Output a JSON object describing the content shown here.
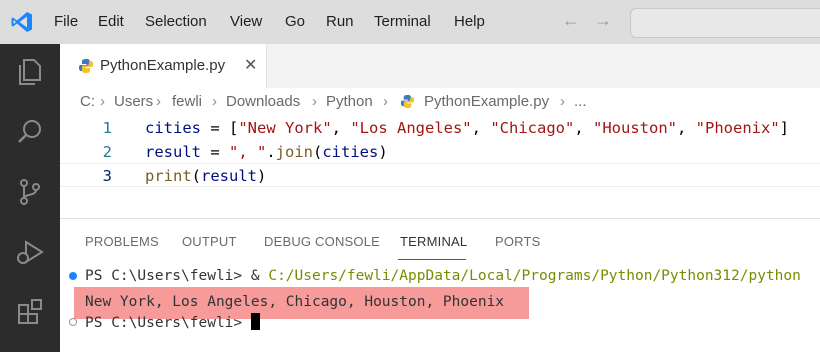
{
  "menu": [
    "File",
    "Edit",
    "Selection",
    "View",
    "Go",
    "Run",
    "Terminal",
    "Help"
  ],
  "colors": {
    "accent": "#1a85ff",
    "activitybar": "#2c2c2c",
    "highlight": "#f69a9a"
  },
  "tab": {
    "label": "PythonExample.py",
    "close": "✕"
  },
  "breadcrumb": [
    "C:",
    "Users",
    "fewli",
    "Downloads",
    "Python",
    "PythonExample.py",
    "..."
  ],
  "editor": {
    "line_numbers": [
      "1",
      "2",
      "3"
    ],
    "line1": {
      "var": "cities",
      "eq": " = [",
      "s1": "\"New York\"",
      "c1": ", ",
      "s2": "\"Los Angeles\"",
      "c2": ", ",
      "s3": "\"Chicago\"",
      "c3": ", ",
      "s4": "\"Houston\"",
      "c4": ", ",
      "s5": "\"Phoenix\"",
      "end": "]"
    },
    "line2": {
      "var": "result",
      "eq": " = ",
      "str": "\", \"",
      "dot": ".",
      "fn": "join",
      "open": "(",
      "arg": "cities",
      "close": ")"
    },
    "line3": {
      "fn": "print",
      "open": "(",
      "arg": "result",
      "close": ")"
    }
  },
  "panel": {
    "tabs": [
      "PROBLEMS",
      "OUTPUT",
      "DEBUG CONSOLE",
      "TERMINAL",
      "PORTS"
    ],
    "active_tab": "TERMINAL"
  },
  "terminal": {
    "prompt": "PS C:\\Users\\fewli> ",
    "cmd_amp": "& ",
    "cmd_path": "C:/Users/fewli/AppData/Local/Programs/Python/Python312/python",
    "output": "New York, Los Angeles, Chicago, Houston, Phoenix",
    "prompt2": "PS C:\\Users\\fewli> "
  }
}
